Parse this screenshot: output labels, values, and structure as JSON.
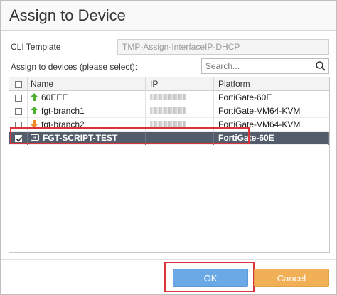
{
  "dialog": {
    "title": "Assign to Device",
    "cli_template_label": "CLI Template",
    "cli_template_value": "TMP-Assign-InterfaceIP-DHCP",
    "assign_label": "Assign to devices (please select):",
    "search_placeholder": "Search..."
  },
  "table": {
    "columns": {
      "name": "Name",
      "ip": "IP",
      "platform": "Platform"
    },
    "rows": [
      {
        "name": "60EEE",
        "platform": "FortiGate-60E",
        "status_icon": "arrow-up-icon",
        "checked": false
      },
      {
        "name": "fgt-branch1",
        "platform": "FortiGate-VM64-KVM",
        "status_icon": "arrow-up-icon",
        "checked": false
      },
      {
        "name": "fgt-branch2",
        "platform": "FortiGate-VM64-KVM",
        "status_icon": "arrow-down-icon",
        "checked": false
      },
      {
        "name": "FGT-SCRIPT-TEST",
        "platform": "FortiGate-60E",
        "status_icon": "device-icon",
        "checked": true
      }
    ]
  },
  "buttons": {
    "ok": "OK",
    "cancel": "Cancel"
  },
  "colors": {
    "selected_row": "#525c6b",
    "ok_button": "#6aa8e6",
    "cancel_button": "#f1b055",
    "highlight": "#d9343b",
    "status_up": "#4caf30",
    "status_down": "#f08a24"
  }
}
